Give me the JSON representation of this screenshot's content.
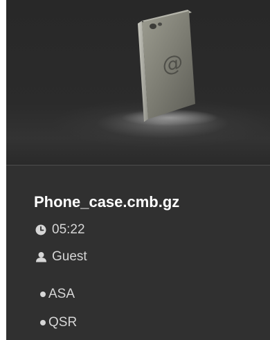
{
  "file": {
    "name": "Phone_case.cmb.gz",
    "time": "05:22",
    "owner": "Guest",
    "tags": [
      "ASA",
      "QSR"
    ],
    "thumbnail_icon": "phone-case-model"
  },
  "colors": {
    "card_background": "#303030",
    "title_text": "#ffffff",
    "meta_text": "#d6d6d6"
  }
}
